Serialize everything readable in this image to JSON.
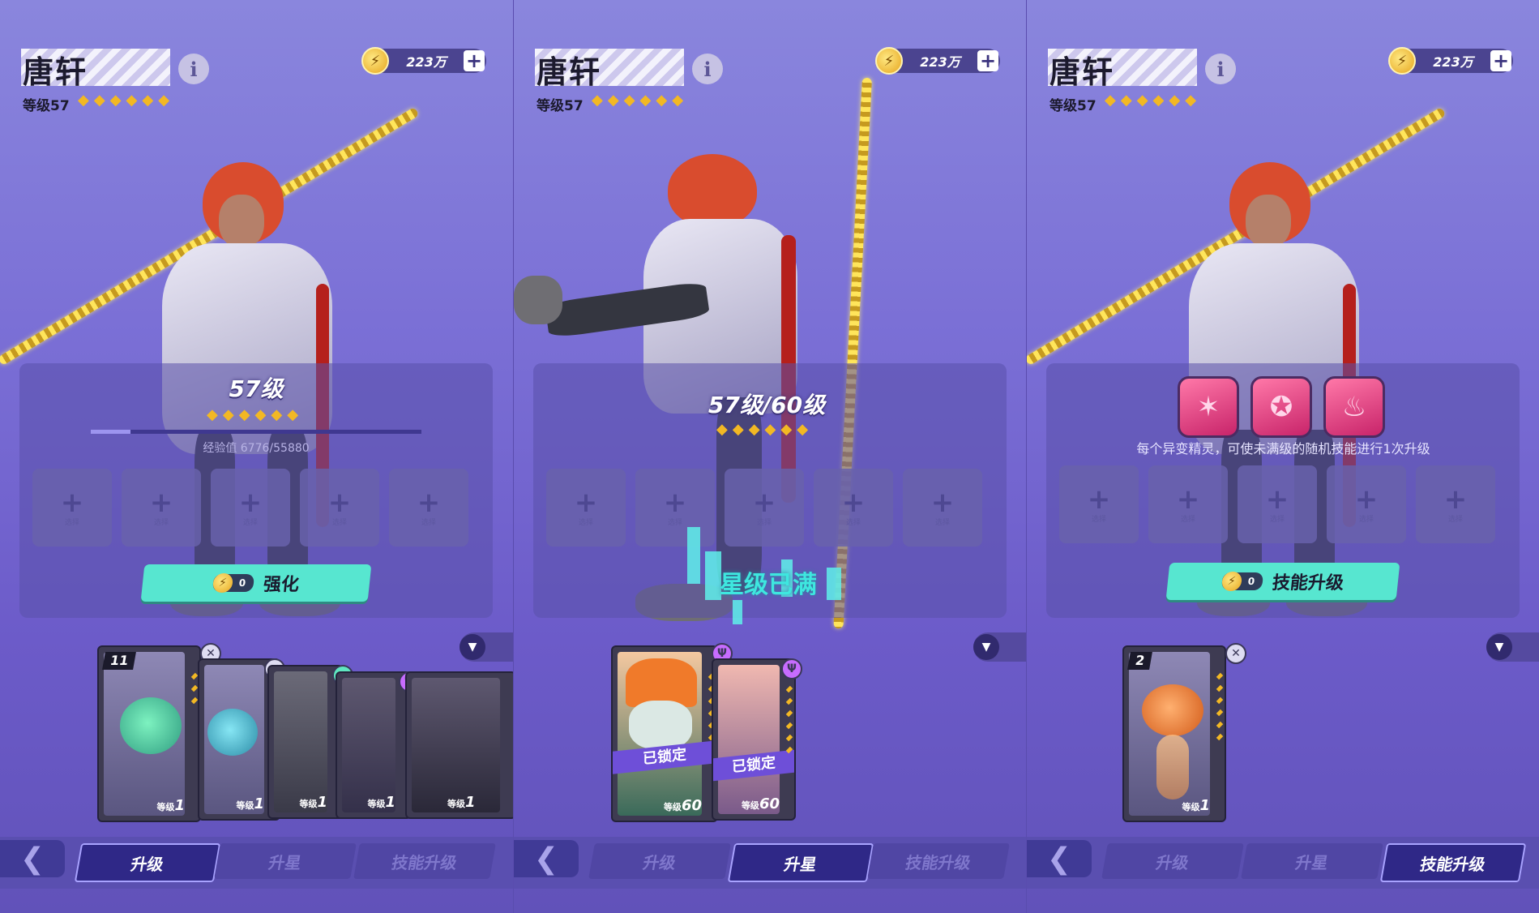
{
  "character": {
    "name": "唐轩",
    "level_label": "等级57",
    "star_count": 6
  },
  "currency": {
    "amount": "223万",
    "coin_symbol": "⚡",
    "plus_symbol": "+"
  },
  "info_symbol": "i",
  "slots": {
    "plus": "+",
    "label": "选择",
    "count": 5
  },
  "panel1": {
    "level_big": "57级",
    "xp_text": "经验值 6776/55880",
    "xp_progress": 0.121,
    "action": {
      "cost": "0",
      "label": "强化"
    },
    "cards": [
      {
        "count": "11",
        "level_label": "等级",
        "level": "1"
      },
      {
        "level_label": "等级",
        "level": "1"
      },
      {
        "level_label": "等级",
        "level": "1"
      },
      {
        "level_label": "等级",
        "level": "1"
      },
      {
        "level_label": "等级",
        "level": "1"
      }
    ]
  },
  "panel2": {
    "level_big": "57级/60级",
    "star_full_text": "星级已满",
    "cards": [
      {
        "locked": "已锁定",
        "level_label": "等级",
        "level": "60"
      },
      {
        "locked": "已锁定",
        "level_label": "等级",
        "level": "60"
      }
    ]
  },
  "panel3": {
    "skill_hint": "每个异变精灵，可使未满级的随机技能进行1次升级",
    "action": {
      "cost": "0",
      "label": "技能升级"
    },
    "cards": [
      {
        "count": "2",
        "level_label": "等级",
        "level": "1"
      }
    ]
  },
  "tabs": {
    "back_symbol": "❮",
    "upgrade": "升级",
    "star_up": "升星",
    "skill_up": "技能升级"
  },
  "colors": {
    "accent_button": "#57e6d0",
    "star": "#f2b824",
    "active_tab": "#2f2887",
    "skill_icon": "#ff78a8"
  },
  "icons": {
    "filter": "filter-funnel-icon",
    "badge": "element-badge-icon",
    "skill1": "slash-skill-icon",
    "skill2": "pentagram-skill-icon",
    "skill3": "flame-skill-icon"
  }
}
